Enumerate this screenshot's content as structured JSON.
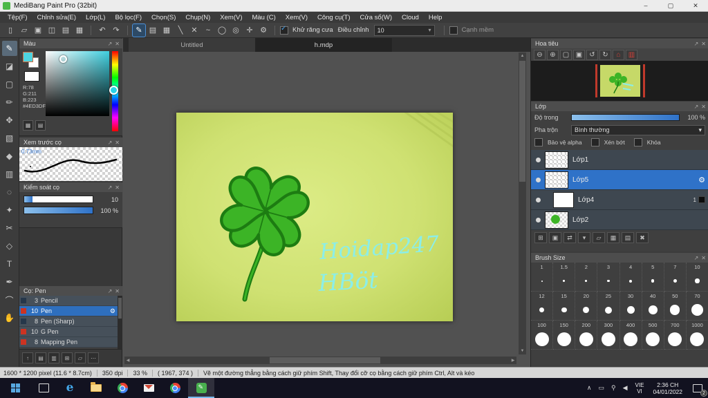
{
  "titlebar": {
    "title": "MediBang Paint Pro (32bit)",
    "minimize": "–",
    "maximize": "▢",
    "close": "✕"
  },
  "menus": [
    "Tệp(F)",
    "Chỉnh sửa(E)",
    "Lớp(L)",
    "Bộ lọc(F)",
    "Chọn(S)",
    "Chụp(N)",
    "Xem(V)",
    "Màu (C)",
    "Xem(V)",
    "Công cụ(T)",
    "Cửa sổ(W)",
    "Cloud",
    "Help"
  ],
  "toolbar": {
    "file_icons": [
      {
        "name": "new-file-icon",
        "glyph": "▯"
      },
      {
        "name": "open-file-icon",
        "glyph": "▱"
      },
      {
        "name": "save-icon",
        "glyph": "▣"
      },
      {
        "name": "comment-icon",
        "glyph": "◫"
      },
      {
        "name": "image-icon",
        "glyph": "▤"
      },
      {
        "name": "grid-icon",
        "glyph": "▦"
      }
    ],
    "undo_icons": [
      {
        "name": "undo-icon",
        "glyph": "↶"
      },
      {
        "name": "redo-icon",
        "glyph": "↷"
      }
    ],
    "snap_icons": [
      {
        "name": "snap-pen-icon",
        "glyph": "✎",
        "selected": true
      },
      {
        "name": "snap-parallel-icon",
        "glyph": "▤"
      },
      {
        "name": "snap-grid-icon",
        "glyph": "▦"
      },
      {
        "name": "snap-diagonal-icon",
        "glyph": "╲"
      },
      {
        "name": "snap-cross-icon",
        "glyph": "✕"
      },
      {
        "name": "snap-curve-icon",
        "glyph": "~"
      },
      {
        "name": "snap-ellipse-icon",
        "glyph": "◯"
      },
      {
        "name": "snap-radial-icon",
        "glyph": "◎"
      },
      {
        "name": "snap-vanish-icon",
        "glyph": "✛"
      },
      {
        "name": "snap-settings-icon",
        "glyph": "⚙"
      }
    ],
    "antialias_label": "Khử răng cưa",
    "adjust_label": "Điều chỉnh",
    "adjust_value": "10",
    "soft_edge_label": "Cạnh mềm"
  },
  "tools": [
    {
      "name": "pen-tool",
      "glyph": "✎",
      "selected": true
    },
    {
      "name": "eraser-tool",
      "glyph": "◪"
    },
    {
      "name": "rect-select-tool",
      "glyph": "▢"
    },
    {
      "name": "marker-tool",
      "glyph": "✏"
    },
    {
      "name": "move-tool",
      "glyph": "✥"
    },
    {
      "name": "select-tool",
      "glyph": "▧"
    },
    {
      "name": "fill-tool",
      "glyph": "◆"
    },
    {
      "name": "gradient-tool",
      "glyph": "▥"
    },
    {
      "name": "lasso-tool",
      "glyph": "◌"
    },
    {
      "name": "magic-wand-tool",
      "glyph": "✦"
    },
    {
      "name": "divide-tool",
      "glyph": "✂"
    },
    {
      "name": "shape-tool",
      "glyph": "◇"
    },
    {
      "name": "text-tool",
      "glyph": "T"
    },
    {
      "name": "eyedropper-tool",
      "glyph": "✒"
    },
    {
      "name": "ruler-tool",
      "glyph": "⌒"
    },
    {
      "name": "hand-tool",
      "glyph": "✋"
    }
  ],
  "left_buttons": [
    {
      "name": "dock-toggle-icon",
      "glyph": "↑"
    },
    {
      "name": "add-panel-icon",
      "glyph": "▤"
    },
    {
      "name": "remove-panel-icon",
      "glyph": "▥"
    },
    {
      "name": "panel-grid-icon",
      "glyph": "⊞"
    },
    {
      "name": "panel-folder-icon",
      "glyph": "▱"
    },
    {
      "name": "more-options-icon",
      "glyph": "⋯"
    }
  ],
  "color_panel": {
    "title": "Màu",
    "r": "R:78",
    "g": "G:211",
    "b": "B:223",
    "hex": "#4ED3DF",
    "foreground_color": "#4ED3DF",
    "background_color": "#FFFFFF"
  },
  "preview_panel": {
    "title": "Xem trước cọ",
    "size_label": "0.73mm"
  },
  "control_panel": {
    "title": "Kiểm soát cọ",
    "value1": "10",
    "value2": "100 %"
  },
  "brush_panel": {
    "title": "Cọ: Pen",
    "items": [
      {
        "size": "3",
        "name": "Pencil",
        "swatch": "#26374a"
      },
      {
        "size": "10",
        "name": "Pen",
        "swatch": "#cc3322",
        "selected": true
      },
      {
        "size": "8",
        "name": "Pen (Sharp)",
        "swatch": "#26374a"
      },
      {
        "size": "10",
        "name": "G Pen",
        "swatch": "#cc3322"
      },
      {
        "size": "8",
        "name": "Mapping Pen",
        "swatch": "#cc3322"
      }
    ]
  },
  "tabs": [
    {
      "label": "Untitled"
    },
    {
      "label": "h.mdp",
      "active": true
    }
  ],
  "canvas": {
    "text_line1": "Hoidap247",
    "text_line2": "HBöt"
  },
  "navigator": {
    "title": "Hoa tiêu",
    "buttons": [
      {
        "name": "zoom-out-icon",
        "glyph": "⊖"
      },
      {
        "name": "zoom-in-icon",
        "glyph": "⊕"
      },
      {
        "name": "fit-window-icon",
        "glyph": "▢"
      },
      {
        "name": "actual-size-icon",
        "glyph": "▣"
      },
      {
        "name": "rotate-left-icon",
        "glyph": "↺"
      },
      {
        "name": "rotate-right-icon",
        "glyph": "↻"
      },
      {
        "name": "reset-view-icon",
        "glyph": "⌂",
        "accent": "#d04038"
      },
      {
        "name": "canvas-border-icon",
        "glyph": "▥",
        "accent": "#d04038"
      }
    ]
  },
  "layers": {
    "title": "Lớp",
    "opacity_label": "Độ trong",
    "opacity_value": "100 %",
    "blend_label": "Pha trộn",
    "blend_value": "Bình thường",
    "protect_alpha_label": "Bảo vệ alpha",
    "clipping_label": "Xén bớt",
    "lock_label": "Khóa",
    "items": [
      {
        "name": "Lớp1",
        "thumb": "checker"
      },
      {
        "name": "Lớp5",
        "thumb": "checker",
        "selected": true,
        "gear": true
      },
      {
        "name": "Lớp4",
        "thumb": "white",
        "indent": true,
        "badge": "1"
      },
      {
        "name": "Lớp2",
        "thumb": "clover"
      }
    ],
    "buttons": [
      {
        "name": "new-layer-icon",
        "glyph": "⊞"
      },
      {
        "name": "duplicate-layer-icon",
        "glyph": "▣"
      },
      {
        "name": "layer-convert-icon",
        "glyph": "⇄"
      },
      {
        "name": "layer-menu-icon",
        "glyph": "▾"
      },
      {
        "name": "layer-folder-icon",
        "glyph": "▱"
      },
      {
        "name": "merge-layer-icon",
        "glyph": "▦"
      },
      {
        "name": "material-icon",
        "glyph": "▤"
      },
      {
        "name": "delete-layer-icon",
        "glyph": "✖"
      }
    ]
  },
  "brush_size": {
    "title": "Brush Size",
    "sizes": [
      "1",
      "1.5",
      "2",
      "3",
      "4",
      "5",
      "7",
      "10",
      "12",
      "15",
      "20",
      "25",
      "30",
      "40",
      "50",
      "70",
      "100",
      "150",
      "200",
      "300",
      "400",
      "500",
      "700",
      "1000"
    ]
  },
  "statusbar": {
    "size_info": "1600 * 1200 pixel (11.6 * 8.7cm)",
    "dpi": "350 dpi",
    "zoom": "33 %",
    "coords": "( 1967, 374 )",
    "hint": "Vẽ một đường thẳng bằng cách giữ phím Shift, Thay đổi cỡ cọ bằng cách giữ phím Ctrl, Alt và kéo"
  },
  "taskbar": {
    "apps": [
      {
        "name": "taskbar-task-view",
        "icon": "taskview"
      },
      {
        "name": "taskbar-edge",
        "icon": "edge"
      },
      {
        "name": "taskbar-file-explorer",
        "icon": "folder"
      },
      {
        "name": "taskbar-chrome",
        "icon": "chrome"
      },
      {
        "name": "taskbar-mail",
        "icon": "mail"
      },
      {
        "name": "taskbar-chrome-2",
        "icon": "chrome"
      },
      {
        "name": "taskbar-medibang",
        "icon": "medibang",
        "active": true
      }
    ],
    "lang_line1": "VIE",
    "lang_line2": "VI",
    "time": "2:36 CH",
    "date": "04/01/2022",
    "notification_count": "2"
  },
  "colors": {
    "accent_blue": "#2f72c8",
    "selected_brush": "#2e6fbe",
    "canvas_green": "#bfd45e",
    "clover_green": "#3cb426",
    "clover_outline": "#1d7c12",
    "canvas_text_cyan": "#8beee8",
    "swatch_red": "#cc3322"
  }
}
